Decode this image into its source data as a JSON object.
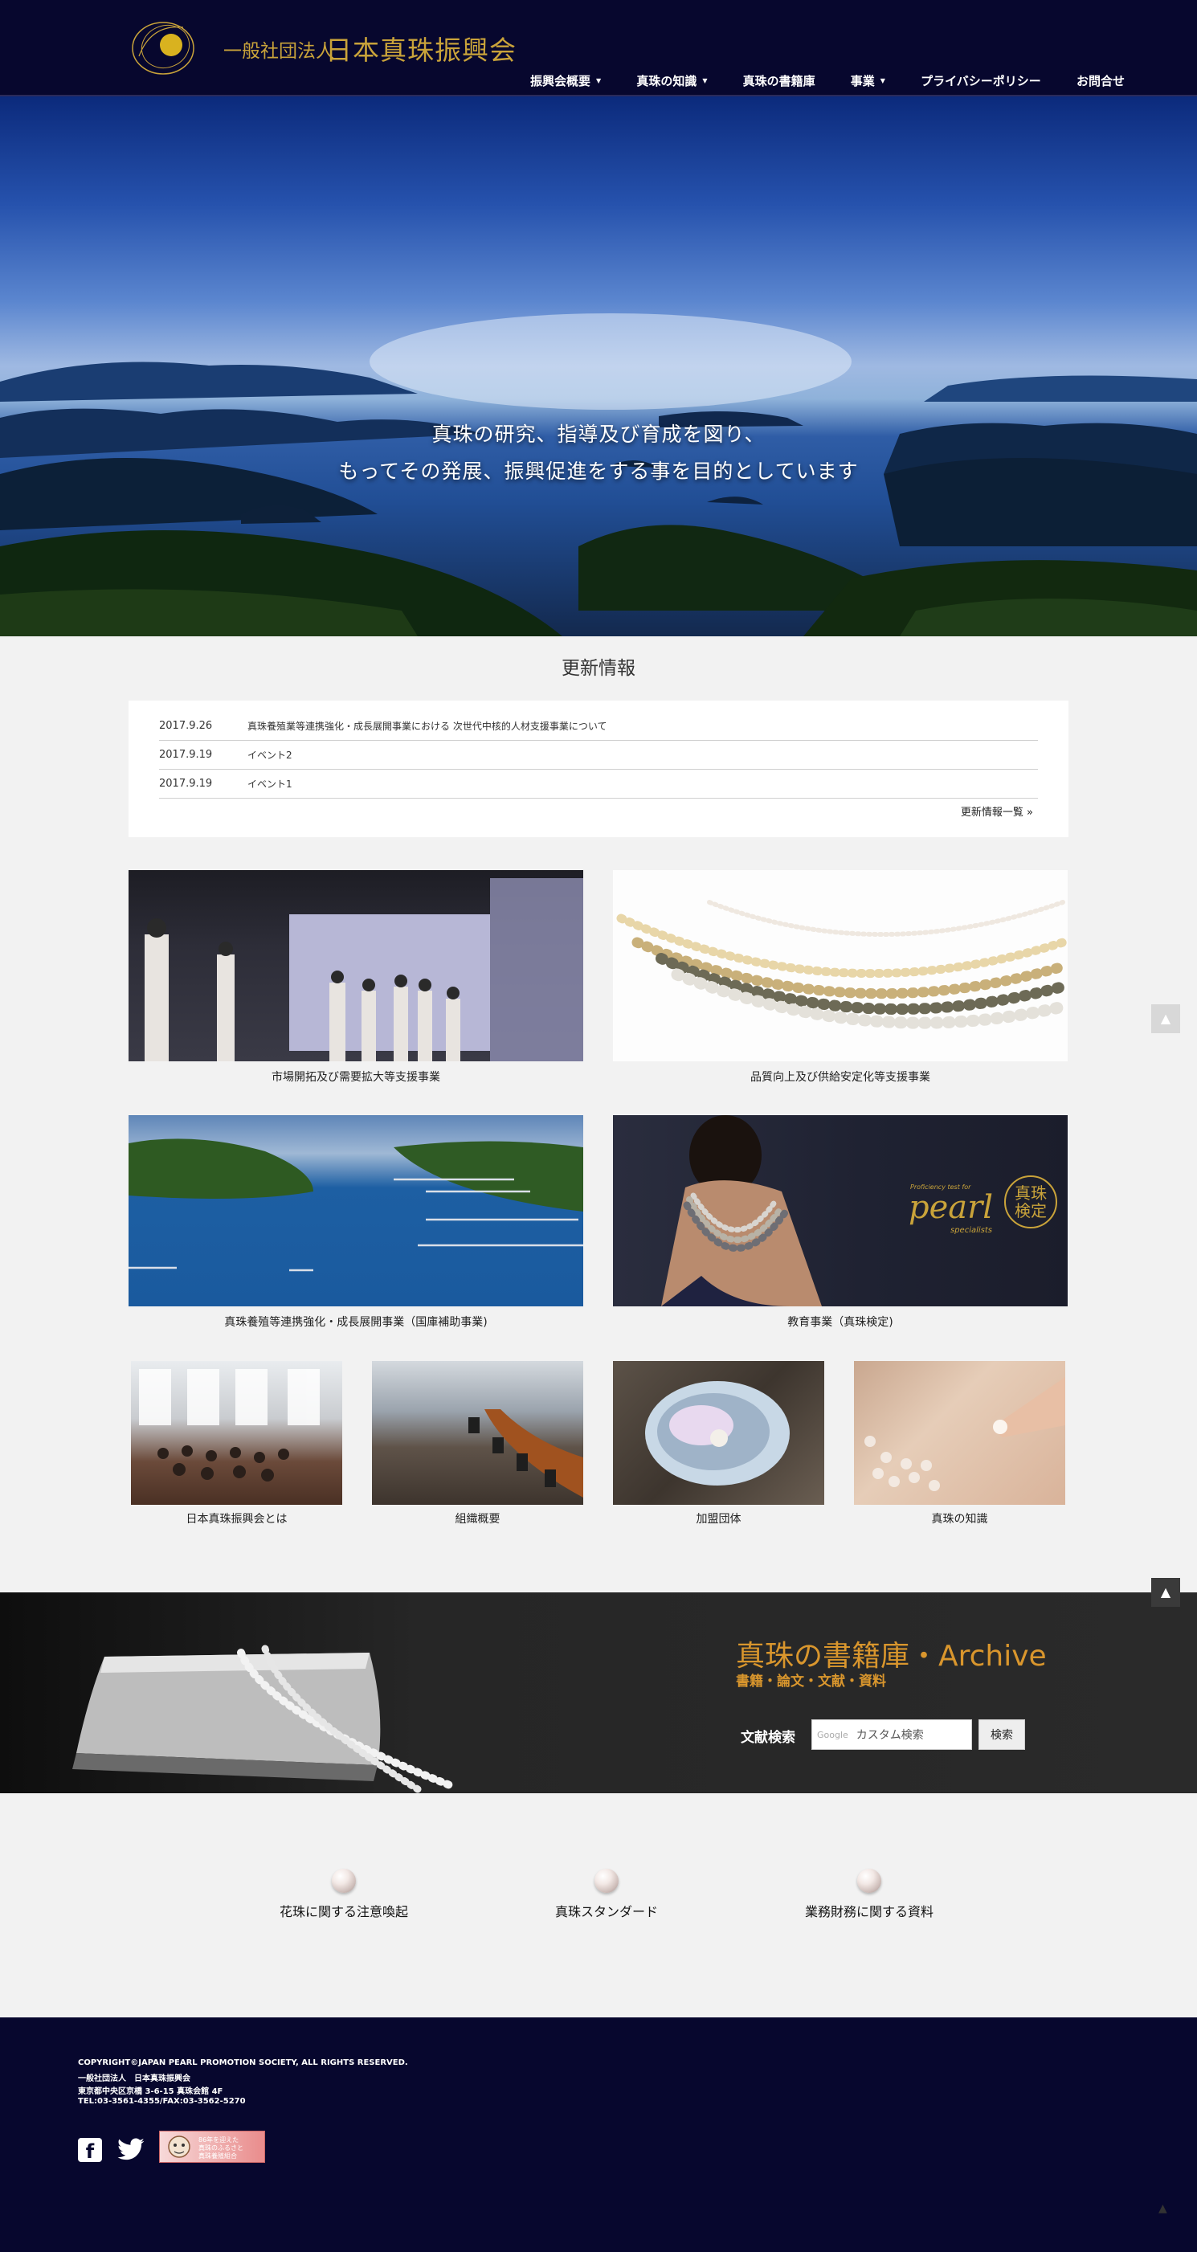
{
  "header": {
    "logo_small": "一般社団法人",
    "logo_big": "日本真珠振興会",
    "nav": [
      {
        "label": "振興会概要",
        "dropdown": true
      },
      {
        "label": "真珠の知識",
        "dropdown": true
      },
      {
        "label": "真珠の書籍庫",
        "dropdown": false
      },
      {
        "label": "事業",
        "dropdown": true
      },
      {
        "label": "プライバシーポリシー",
        "dropdown": false
      },
      {
        "label": "お問合せ",
        "dropdown": false
      }
    ]
  },
  "hero": {
    "line1": "真珠の研究、指導及び育成を図り、",
    "line2": "もってその発展、振興促進をする事を目的としています"
  },
  "news": {
    "title": "更新情報",
    "items": [
      {
        "date": "2017.9.26",
        "text": "真珠養殖業等連携強化・成長展開事業における 次世代中核的人材支援事業について"
      },
      {
        "date": "2017.9.19",
        "text": "イベント2"
      },
      {
        "date": "2017.9.19",
        "text": "イベント1"
      }
    ],
    "more": "更新情報一覧 »"
  },
  "business": [
    {
      "caption": "市場開拓及び需要拡大等支援事業"
    },
    {
      "caption": "品質向上及び供給安定化等支援事業"
    },
    {
      "caption": "真珠養殖等連携強化・成長展開事業（国庫補助事業)"
    },
    {
      "caption": "教育事業（真珠検定)",
      "overlay_en": "pearl",
      "overlay_en_top": "Proficiency test for",
      "overlay_en_bottom": "specialists",
      "overlay_seal": "真珠検定"
    }
  ],
  "about": [
    {
      "caption": "日本真珠振興会とは"
    },
    {
      "caption": "組織概要"
    },
    {
      "caption": "加盟団体"
    },
    {
      "caption": "真珠の知識"
    }
  ],
  "archive": {
    "title": "真珠の書籍庫・Archive",
    "subtitle": "書籍・論文・文献・資料",
    "search_label": "文献検索",
    "search_brand": "Google",
    "search_placeholder": "カスタム検索",
    "search_button": "検索"
  },
  "links": [
    {
      "label": "花珠に関する注意喚起"
    },
    {
      "label": "真珠スタンダード"
    },
    {
      "label": "業務財務に関する資料"
    }
  ],
  "footer": {
    "copyright": "COPYRIGHT©JAPAN PEARL PROMOTION SOCIETY, ALL RIGHTS RESERVED.",
    "org": "一般社団法人　日本真珠振興会",
    "address": "東京都中央区京橋 3-6-15 真珠会館 4F",
    "tel": "TEL:03-3561-4355/FAX:03-3562-5270",
    "banner_line1": "86年を迎えた",
    "banner_line2": "真珠のふるさと",
    "banner_line3": "真珠養殖組合"
  },
  "colors": {
    "header_bg": "#07072e",
    "accent_gold": "#c9a33a",
    "archive_orange": "#d9962d"
  }
}
